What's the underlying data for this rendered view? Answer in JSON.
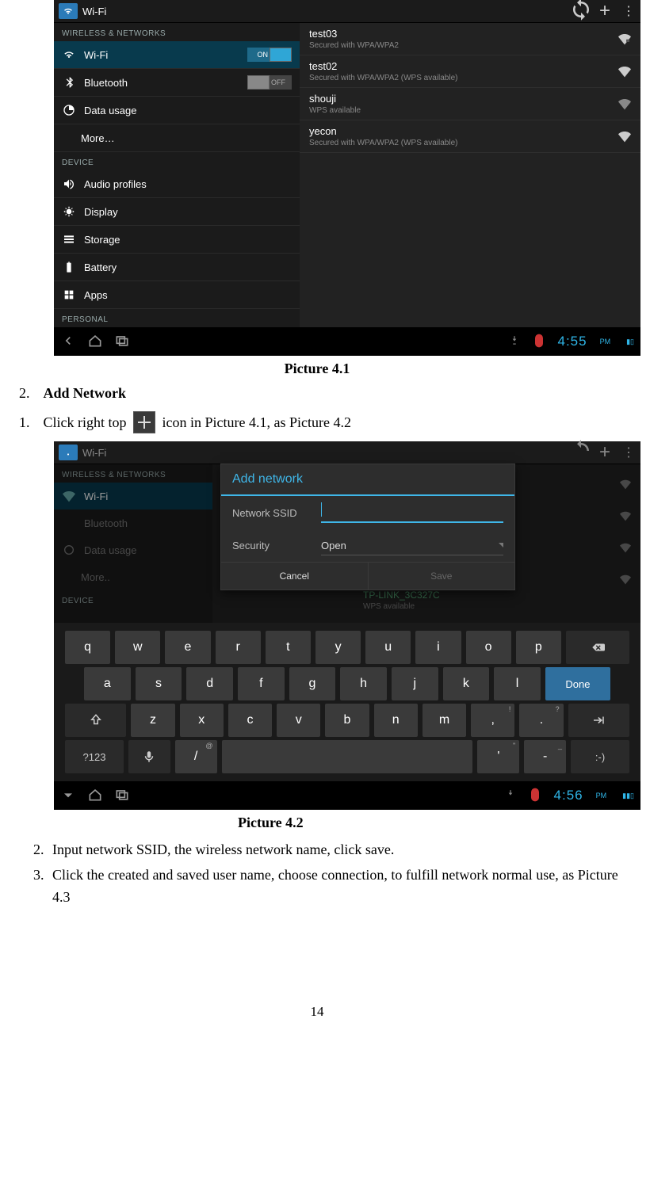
{
  "caption1": "Picture 4.1",
  "caption2": "Picture 4.2",
  "section2": {
    "num": "2.",
    "title": "Add Network"
  },
  "step1": {
    "num": "1.",
    "pre": "Click right top",
    "post": " icon in Picture 4.1, as Picture 4.2"
  },
  "substeps": {
    "s2": "Input network SSID, the wireless network name, click save.",
    "s3": "Click the created and saved user name, choose connection, to fulfill network normal use, as Picture 4.3"
  },
  "pagenum": "14",
  "shot1": {
    "title": "Wi-Fi",
    "nav": {
      "section_wn": "WIRELESS & NETWORKS",
      "section_dev": "DEVICE",
      "section_pers": "PERSONAL",
      "wifi": "Wi-Fi",
      "wifi_state": "ON",
      "bt": "Bluetooth",
      "bt_state": "OFF",
      "data": "Data usage",
      "more": "More…",
      "audio": "Audio profiles",
      "display": "Display",
      "storage": "Storage",
      "battery": "Battery",
      "apps": "Apps"
    },
    "nets": [
      {
        "ssid": "test03",
        "sub": "Secured with WPA/WPA2",
        "secure": true
      },
      {
        "ssid": "test02",
        "sub": "Secured with WPA/WPA2 (WPS available)",
        "secure": true
      },
      {
        "ssid": "shouji",
        "sub": "WPS available",
        "secure": false
      },
      {
        "ssid": "yecon",
        "sub": "Secured with WPA/WPA2 (WPS available)",
        "secure": true
      }
    ],
    "time": "4:55",
    "ampm": "PM"
  },
  "shot2": {
    "title": "Wi-Fi",
    "nav": {
      "section_wn": "WIRELESS & NETWORKS",
      "section_dev": "DEVICE",
      "wifi": "Wi-Fi",
      "bt": "Bluetooth",
      "data": "Data usage",
      "more": "More.."
    },
    "hidden_net": {
      "ssid": "TP-LINK_3C327C",
      "sub": "WPS available"
    },
    "dialog": {
      "title": "Add network",
      "ssid_label": "Network SSID",
      "sec_label": "Security",
      "sec_value": "Open",
      "cancel": "Cancel",
      "save": "Save"
    },
    "kbd": {
      "r1": [
        "q",
        "w",
        "e",
        "r",
        "t",
        "y",
        "u",
        "i",
        "o",
        "p"
      ],
      "r2": [
        "a",
        "s",
        "d",
        "f",
        "g",
        "h",
        "j",
        "k",
        "l"
      ],
      "r3": [
        "z",
        "x",
        "c",
        "v",
        "b",
        "n",
        "m",
        ",",
        "."
      ],
      "done": "Done",
      "numkey": "?123",
      "slash": "/",
      "apos": "'",
      "dash": "-",
      "smile": ":-)",
      "sup_comma": "!",
      "sup_period": "?",
      "sup_slash": "@",
      "sup_apos": "\"",
      "sup_dash": "_"
    },
    "time": "4:56",
    "ampm": "PM"
  }
}
